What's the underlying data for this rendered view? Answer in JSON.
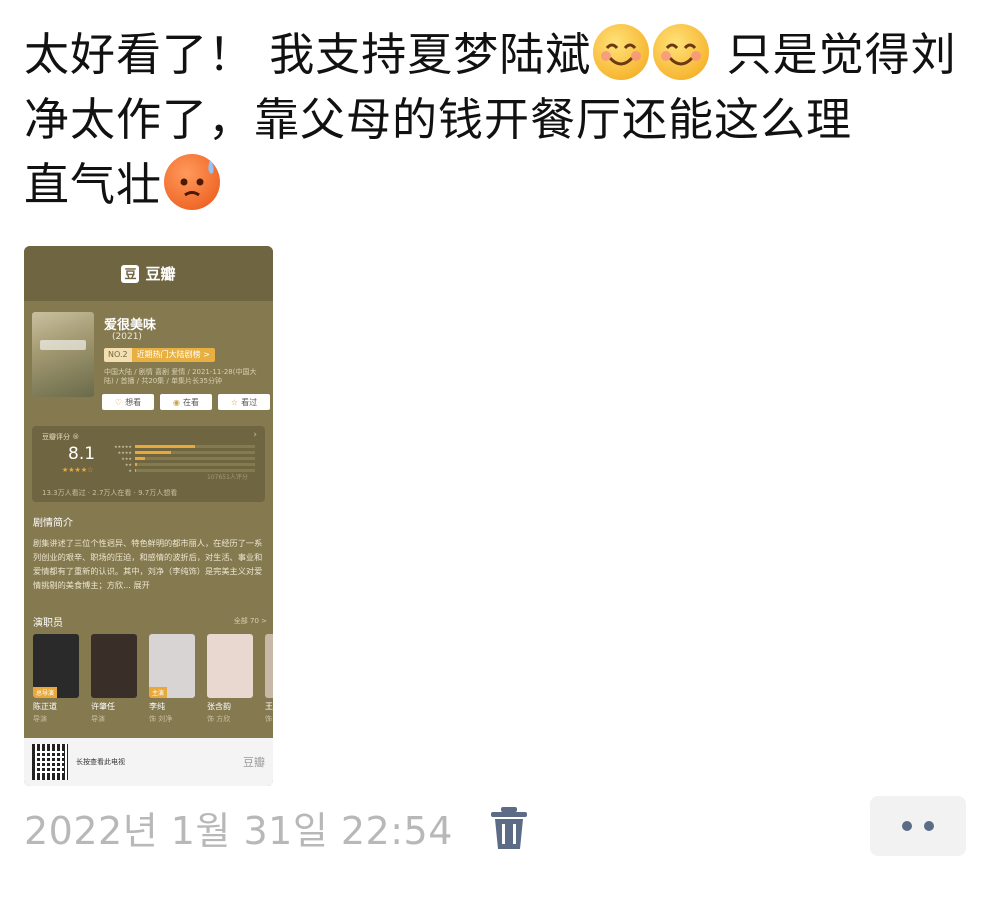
{
  "post": {
    "line1": "太好看了！ 我支持夏梦陆斌",
    "line1b": " 只是觉得刘",
    "line2": "净太作了，靠父母的钱开餐厅还能这么理",
    "line3": "直气壮",
    "emojis": [
      "smiling-face-icon",
      "smiling-face-icon",
      "anxious-sweat-face-icon"
    ]
  },
  "share_card": {
    "brand": "豆瓣",
    "brand_icon": "豆",
    "movie": {
      "title": "爱很美味",
      "year": "(2021)",
      "rank_no": "NO.2",
      "rank_text": "近期热门大陆剧榜 >",
      "meta": "中国大陆 / 剧情 喜剧 爱情 / 2021-11-28(中国大陆) / 首播 / 共20集 / 单集片长35分钟",
      "actions": [
        {
          "icon": "heart-icon",
          "label": "想看"
        },
        {
          "icon": "eye-icon",
          "label": "在看"
        },
        {
          "icon": "star-icon",
          "label": "看过"
        }
      ]
    },
    "rating": {
      "label": "豆瓣评分 ®",
      "score": "8.1",
      "stars": "★★★★☆",
      "distribution": [
        0.55,
        0.33,
        0.09,
        0.02,
        0.01
      ],
      "count": "107651人评分",
      "footer": "13.3万人看过 · 2.7万人在看 · 9.7万人想看"
    },
    "synopsis": {
      "title": "剧情简介",
      "text": "剧集讲述了三位个性迥异、特色鲜明的都市丽人，在经历了一系列创业的艰辛、职场的压迫，和感情的波折后，对生活、事业和爱情都有了重新的认识。其中，刘净（李纯饰）是完美主义对爱情挑剔的美食博主；方欣... 展开"
    },
    "cast": {
      "title": "演职员",
      "more": "全部 70 >",
      "members": [
        {
          "name": "陈正道",
          "role": "导演",
          "tag": "总导演",
          "bg": "#2a2a2a"
        },
        {
          "name": "许肇任",
          "role": "导演",
          "tag": "",
          "bg": "#3a2e28"
        },
        {
          "name": "李纯",
          "role": "饰 刘净",
          "tag": "主演",
          "bg": "#d8d4d4"
        },
        {
          "name": "张含韵",
          "role": "饰 方欣",
          "tag": "",
          "bg": "#e8d8d0"
        },
        {
          "name": "王",
          "role": "饰",
          "tag": "",
          "bg": "#c8b8a8"
        }
      ]
    },
    "footer": {
      "hint": "长按查看此电视",
      "brand": "豆瓣"
    }
  },
  "meta": {
    "timestamp": "2022년 1월 31일 22:54"
  },
  "colors": {
    "card_bg": "#857950",
    "card_dark": "#6f6541",
    "accent": "#e8a93a",
    "timestamp": "#b8b8b8",
    "dots": "#5c6b86"
  }
}
